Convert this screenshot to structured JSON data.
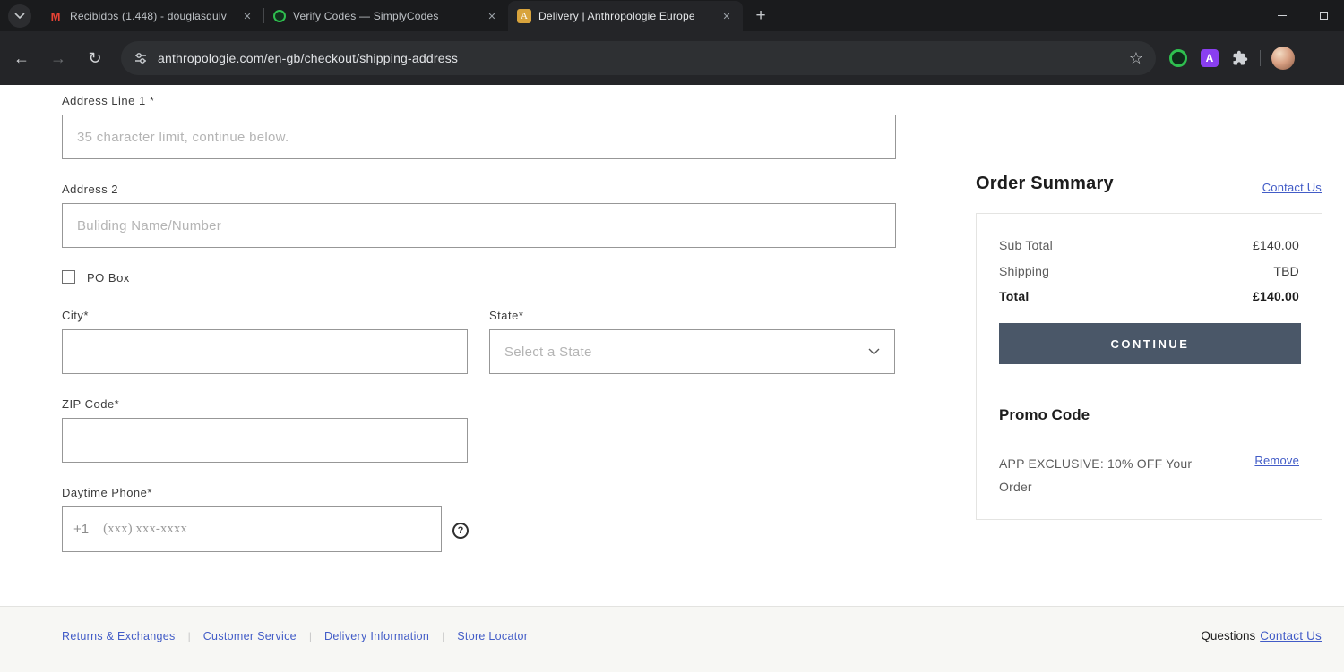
{
  "browser": {
    "tabs": [
      {
        "title": "Recibidos (1.448) - douglasquiv",
        "favicon_letter": "M"
      },
      {
        "title": "Verify Codes — SimplyCodes"
      },
      {
        "title": "Delivery | Anthropologie Europe",
        "favicon_letter": "A",
        "active": true
      }
    ],
    "url": "anthropologie.com/en-gb/checkout/shipping-address",
    "extensions": {
      "a_badge": "A"
    }
  },
  "page": {
    "form": {
      "address1": {
        "label": "Address Line 1 *",
        "placeholder": "35 character limit, continue below."
      },
      "address2": {
        "label": "Address 2",
        "placeholder": "Buliding Name/Number"
      },
      "po_box": {
        "label": "PO Box",
        "checked": false
      },
      "city": {
        "label": "City*",
        "value": ""
      },
      "state": {
        "label": "State*",
        "selected_option": "Select a State"
      },
      "zip": {
        "label": "ZIP Code*",
        "value": ""
      },
      "phone": {
        "label": "Daytime Phone*",
        "prefix": "+1",
        "placeholder": "(xxx) xxx-xxxx",
        "help": "?"
      }
    },
    "order_summary": {
      "title": "Order Summary",
      "contact_us_label": "Contact Us",
      "rows": [
        {
          "label": "Sub Total",
          "value": "£140.00"
        },
        {
          "label": "Shipping",
          "value": "TBD"
        },
        {
          "label": "Total",
          "value": "£140.00"
        }
      ],
      "continue_label": "CONTINUE",
      "promo": {
        "title": "Promo Code",
        "applied": "APP EXCLUSIVE: 10% OFF Your Order",
        "remove_label": "Remove"
      }
    },
    "footer": {
      "links": [
        "Returns & Exchanges",
        "Customer Service",
        "Delivery Information",
        "Store Locator"
      ],
      "questions_label": "Questions",
      "contact_us_label": "Contact Us"
    }
  },
  "colors": {
    "link_blue": "#425cc7",
    "continue_button": "#4a5768",
    "anthropologie_gold": "#d8a33c",
    "extension_purple": "#8a3ff0",
    "simplycodes_green": "#2fbf4f"
  }
}
